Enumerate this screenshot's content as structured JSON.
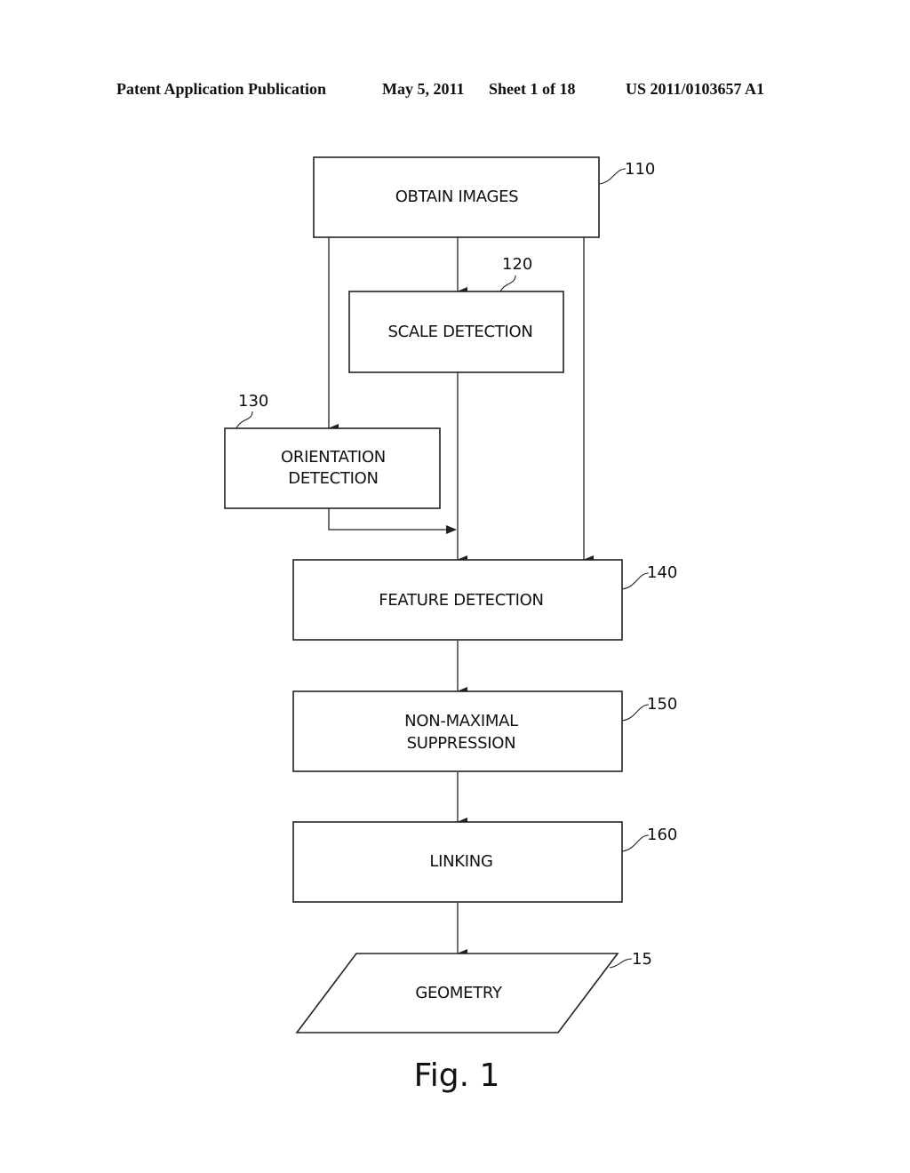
{
  "header": {
    "left": "Patent Application Publication",
    "date": "May 5, 2011",
    "sheet": "Sheet 1 of 18",
    "number": "US 2011/0103657 A1"
  },
  "steps": {
    "obtain_images": {
      "label": "OBTAIN IMAGES",
      "ref": "110"
    },
    "scale_detection": {
      "label": "SCALE DETECTION",
      "ref": "120"
    },
    "orientation_detection": {
      "line1": "ORIENTATION",
      "line2": "DETECTION",
      "ref": "130"
    },
    "feature_detection": {
      "label": "FEATURE DETECTION",
      "ref": "140"
    },
    "non_maximal_suppression": {
      "line1": "NON-MAXIMAL",
      "line2": "SUPPRESSION",
      "ref": "150"
    },
    "linking": {
      "label": "LINKING",
      "ref": "160"
    },
    "geometry": {
      "label": "GEOMETRY",
      "ref": "15"
    }
  },
  "figure_caption": "Fig. 1"
}
